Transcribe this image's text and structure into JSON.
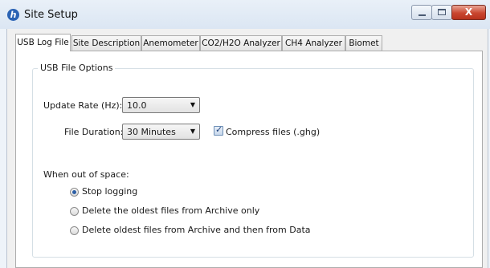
{
  "window": {
    "title": "Site Setup",
    "close_symbol": "X",
    "icon": "app-logo-icon"
  },
  "tabs": [
    {
      "label": "USB Log File",
      "active": true
    },
    {
      "label": "Site Description",
      "active": false
    },
    {
      "label": "Anemometer",
      "active": false
    },
    {
      "label": "CO2/H2O Analyzer",
      "active": false
    },
    {
      "label": "CH4 Analyzer",
      "active": false
    },
    {
      "label": "Biomet",
      "active": false
    }
  ],
  "group": {
    "title": "USB File Options"
  },
  "fields": {
    "update_rate_label": "Update Rate (Hz):",
    "update_rate_value": "10.0",
    "file_duration_label": "File Duration:",
    "file_duration_value": "30 Minutes",
    "compress_label": "Compress files (.ghg)",
    "compress_checked": true
  },
  "out_of_space": {
    "label": "When out of space:",
    "options": [
      {
        "label": "Stop logging",
        "selected": true
      },
      {
        "label": "Delete the oldest files from Archive only",
        "selected": false
      },
      {
        "label": "Delete oldest files from Archive and then from Data",
        "selected": false
      }
    ]
  },
  "colors": {
    "accent": "#2d5fa6",
    "close_button": "#c9462f"
  }
}
